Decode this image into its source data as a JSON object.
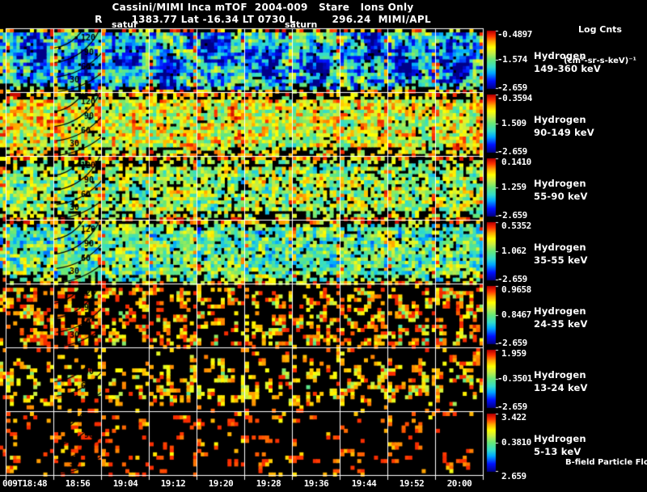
{
  "header": {
    "title": "Cassini/MIMI Inca mTOF  2004-009   Stare   Ions Only",
    "subtitle": "R        1383.77 Lat -16.34 LT 0730 L          296.24  MIMI/APL",
    "units_line1": "Log Cnts",
    "units_line2": "(cm²-sr-s-keV)⁻¹",
    "overlay_labels": [
      "satur",
      "saturn"
    ]
  },
  "rows": [
    {
      "species": "Hydrogen",
      "energy": "149-360 keV",
      "cb_top": "-0.4897",
      "cb_mid": "-1.574",
      "cb_bot": "-2.659"
    },
    {
      "species": "Hydrogen",
      "energy": "90-149 keV",
      "cb_top": "-0.3594",
      "cb_mid": "1.509",
      "cb_bot": "-2.659"
    },
    {
      "species": "Hydrogen",
      "energy": "55-90 keV",
      "cb_top": "0.1410",
      "cb_mid": "1.259",
      "cb_bot": "-2.659"
    },
    {
      "species": "Hydrogen",
      "energy": "35-55 keV",
      "cb_top": "0.5352",
      "cb_mid": "1.062",
      "cb_bot": "-2.659"
    },
    {
      "species": "Hydrogen",
      "energy": "24-35 keV",
      "cb_top": "0.9658",
      "cb_mid": "0.8467",
      "cb_bot": "-2.659"
    },
    {
      "species": "Hydrogen",
      "energy": "13-24 keV",
      "cb_top": "1.959",
      "cb_mid": "-0.3501",
      "cb_bot": "-2.659"
    },
    {
      "species": "Hydrogen",
      "energy": "5-13 keV",
      "cb_top": "3.422",
      "cb_mid": "0.3810",
      "cb_bot": "2.659"
    }
  ],
  "time_axis": [
    "009T18:48",
    "18:56",
    "19:04",
    "19:12",
    "19:20",
    "19:28",
    "19:36",
    "19:44",
    "19:52",
    "20:00"
  ],
  "contour_labels": [
    "120",
    "90",
    "60",
    "30"
  ],
  "footer": {
    "flow_label": "B-field Particle Flow"
  },
  "colors": {
    "background": "#000000",
    "text": "#ffffff",
    "grid": "#ffffff",
    "contour": "#000000",
    "scale_low": "#000088",
    "scale_high": "#bb0000"
  },
  "chart_data": {
    "type": "heatmap",
    "title": "Cassini/MIMI Inca mTOF 2004-009 Stare Ions Only",
    "subtitle_ephemeris": {
      "R": "1383.77",
      "Lat": "-16.34",
      "LT": "0730",
      "L": "296.24",
      "credit": "MIMI/APL"
    },
    "units": "Log Cnts (cm²-sr-s-keV)⁻¹",
    "x_time_labels": [
      "009T18:48",
      "18:56",
      "19:04",
      "19:12",
      "19:20",
      "19:28",
      "19:36",
      "19:44",
      "19:52",
      "20:00"
    ],
    "panel_interval_min": 8,
    "colorscale": "rainbow, blue=low to red=high, black=no counts",
    "pitch_angle_contours_deg": [
      120,
      90,
      60,
      30
    ],
    "series": [
      {
        "name": "Hydrogen 149-360 keV",
        "log_counts_scale_labels": [
          "-0.4897",
          "-1.574",
          "-2.659"
        ],
        "appearance": "dense cyan/blue field with dark-blue blobs, scattered orange-red"
      },
      {
        "name": "Hydrogen 90-149 keV",
        "log_counts_scale_labels": [
          "-0.3594",
          "1.509",
          "-2.659"
        ],
        "appearance": "dense yellow-orange field with red patches"
      },
      {
        "name": "Hydrogen 55-90 keV",
        "log_counts_scale_labels": [
          "0.1410",
          "1.259",
          "-2.659"
        ],
        "appearance": "dense yellow-green field with black speckles"
      },
      {
        "name": "Hydrogen 35-55 keV",
        "log_counts_scale_labels": [
          "0.5352",
          "1.062",
          "-2.659"
        ],
        "appearance": "dense cyan-green-yellow field"
      },
      {
        "name": "Hydrogen 24-35 keV",
        "log_counts_scale_labels": [
          "0.9658",
          "0.8467",
          "-2.659"
        ],
        "appearance": "sparse yellow/green/cyan clusters on black"
      },
      {
        "name": "Hydrogen 13-24 keV",
        "log_counts_scale_labels": [
          "1.959",
          "-0.3501",
          "-2.659"
        ],
        "appearance": "sparse green/yellow clusters concentrated mid-band"
      },
      {
        "name": "Hydrogen 5-13 keV",
        "log_counts_scale_labels": [
          "3.422",
          "0.3810",
          "2.659"
        ],
        "appearance": "very sparse yellow/orange specks on black"
      }
    ]
  },
  "render": {
    "seed": 77,
    "profiles": [
      {
        "mean": 0.38,
        "sS": 0.85,
        "sR": 0.18,
        "black": 0.07,
        "blob": 0.38,
        "topBlack": [
          1,
          0.25
        ],
        "botBlack": [
          2,
          0.35
        ]
      },
      {
        "mean": 0.66,
        "sS": 0.5,
        "sR": 0.28,
        "black": 0.08,
        "blob": 0,
        "topBlack": [
          2,
          0.6
        ],
        "botBlack": [
          2,
          0.5
        ]
      },
      {
        "mean": 0.57,
        "sS": 0.5,
        "sR": 0.26,
        "black": 0.2,
        "blob": 0,
        "topBlack": [
          3,
          0.5
        ],
        "botBlack": [
          2,
          0.45
        ]
      },
      {
        "mean": 0.48,
        "sS": 0.55,
        "sR": 0.22,
        "black": 0.13,
        "blob": 0,
        "topBlack": [
          2,
          0.4
        ],
        "botBlack": [
          2,
          0.4
        ]
      },
      {
        "sparse": true,
        "mean": 0.58,
        "sR": 0.4,
        "thresh": 0.56
      },
      {
        "sparse": true,
        "mean": 0.54,
        "sR": 0.35,
        "thresh": 0.57,
        "band": 0.22
      },
      {
        "sparse": true,
        "mean": 0.66,
        "sR": 0.28,
        "thresh": 0.68
      }
    ]
  }
}
